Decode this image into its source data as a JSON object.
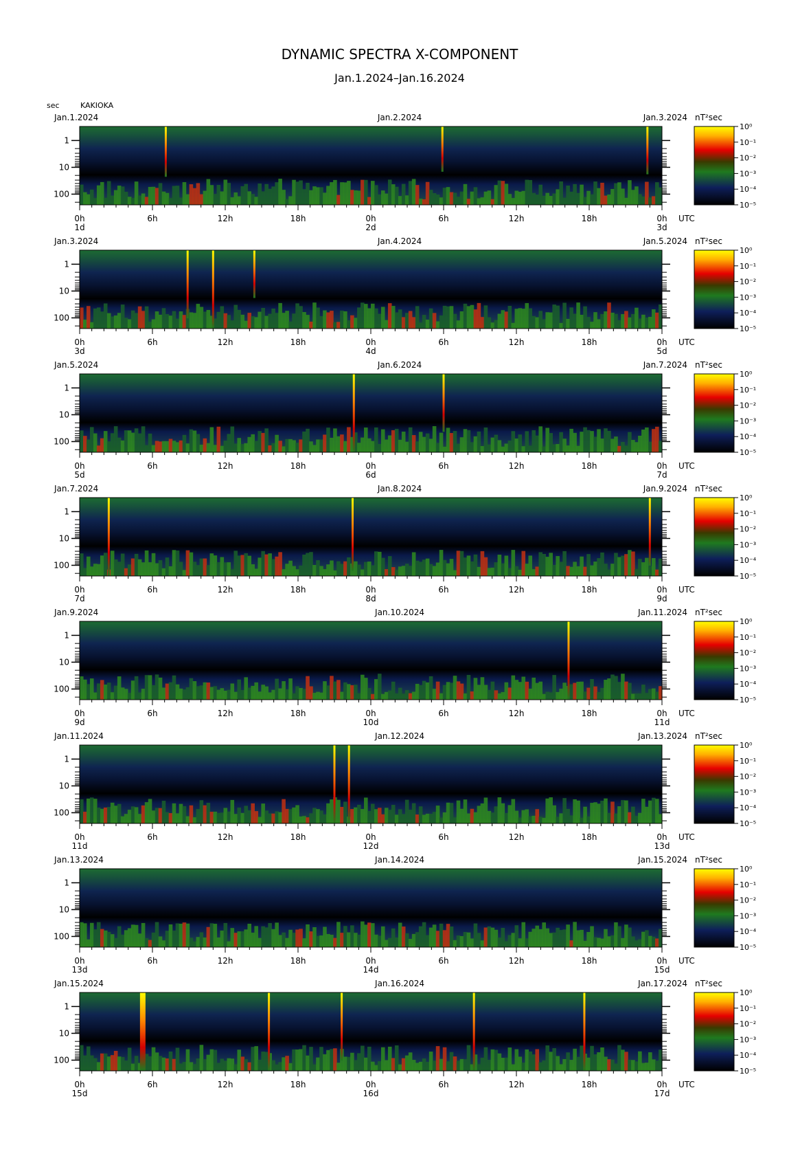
{
  "title": "DYNAMIC SPECTRA X-COMPONENT",
  "subtitle": "Jan.1.2024–Jan.16.2024",
  "yunit": "sec",
  "station": "KAKIOKA",
  "colorbar_unit": "nT²sec",
  "utc_label": "UTC",
  "chart_data": {
    "type": "heatmap",
    "y_axis": {
      "label": "sec",
      "scale": "log",
      "ticks": [
        "1",
        "10",
        "100"
      ],
      "range_sec": [
        0.3,
        250
      ]
    },
    "x_axis": {
      "tick_labels": [
        "0h",
        "6h",
        "12h",
        "18h",
        "0h",
        "6h",
        "12h",
        "18h",
        "0h"
      ],
      "range_hours": [
        0,
        48
      ]
    },
    "colorbar": {
      "unit": "nT²sec",
      "scale": "log",
      "tick_labels": [
        "10⁰",
        "10⁻¹",
        "10⁻²",
        "10⁻³",
        "10⁻⁴",
        "10⁻⁵"
      ],
      "colors": [
        "#ffff00",
        "#ff9900",
        "#e60000",
        "#1f7a1f",
        "#0e1f5a",
        "#000000"
      ]
    },
    "panels": [
      {
        "start": "Jan.1.2024",
        "mid": "Jan.2.2024",
        "end": "Jan.3.2024",
        "day_labels": [
          "1d",
          "2d",
          "3d"
        ],
        "spikes_hours": [
          {
            "h": 7.1,
            "level": 0.45
          },
          {
            "h": 29.9,
            "level": 0.35
          },
          {
            "h": 46.8,
            "level": 0.4
          }
        ]
      },
      {
        "start": "Jan.3.2024",
        "mid": "Jan.4.2024",
        "end": "Jan.5.2024",
        "day_labels": [
          "3d",
          "4d",
          "5d"
        ],
        "spikes_hours": [
          {
            "h": 8.9,
            "level": 0.8
          },
          {
            "h": 11.0,
            "level": 1.0
          },
          {
            "h": 14.4,
            "level": 0.4
          }
        ]
      },
      {
        "start": "Jan.5.2024",
        "mid": "Jan.6.2024",
        "end": "Jan.7.2024",
        "day_labels": [
          "5d",
          "6d",
          "7d"
        ],
        "spikes_hours": [
          {
            "h": 22.6,
            "level": 1.0
          },
          {
            "h": 30.0,
            "level": 0.6
          }
        ]
      },
      {
        "start": "Jan.7.2024",
        "mid": "Jan.8.2024",
        "end": "Jan.9.2024",
        "day_labels": [
          "7d",
          "8d",
          "9d"
        ],
        "spikes_hours": [
          {
            "h": 2.4,
            "level": 1.0
          },
          {
            "h": 22.5,
            "level": 0.9
          },
          {
            "h": 47.0,
            "level": 0.8
          }
        ]
      },
      {
        "start": "Jan.9.2024",
        "mid": "Jan.10.2024",
        "end": "Jan.11.2024",
        "day_labels": [
          "9d",
          "10d",
          "11d"
        ],
        "spikes_hours": [
          {
            "h": 40.3,
            "level": 1.0
          }
        ]
      },
      {
        "start": "Jan.11.2024",
        "mid": "Jan.12.2024",
        "end": "Jan.13.2024",
        "day_labels": [
          "11d",
          "12d",
          "13d"
        ],
        "spikes_hours": [
          {
            "h": 21.0,
            "level": 1.0
          },
          {
            "h": 22.2,
            "level": 1.0
          }
        ]
      },
      {
        "start": "Jan.13.2024",
        "mid": "Jan.14.2024",
        "end": "Jan.15.2024",
        "day_labels": [
          "13d",
          "14d",
          "15d"
        ],
        "spikes_hours": []
      },
      {
        "start": "Jan.15.2024",
        "mid": "Jan.16.2024",
        "end": "Jan.17.2024",
        "day_labels": [
          "15d",
          "16d",
          "17d"
        ],
        "spikes_hours": [
          {
            "h": 5.2,
            "level": 1.2
          },
          {
            "h": 15.6,
            "level": 1.0
          },
          {
            "h": 21.6,
            "level": 0.8
          },
          {
            "h": 32.5,
            "level": 1.0
          },
          {
            "h": 41.6,
            "level": 1.0
          }
        ]
      }
    ]
  }
}
